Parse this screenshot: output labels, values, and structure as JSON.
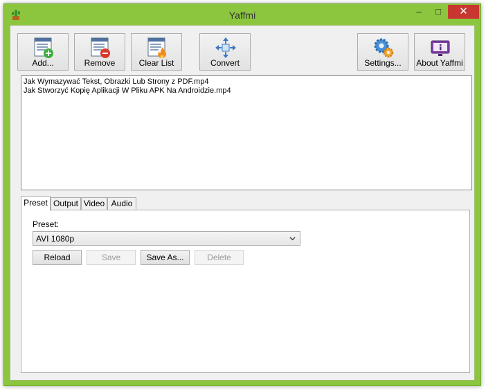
{
  "window": {
    "title": "Yaffmi",
    "app_icon": "cactus-icon",
    "controls": {
      "minimize": "–",
      "maximize": "□",
      "close": "✕"
    },
    "accent_color": "#8cc63f",
    "close_color": "#c7372f"
  },
  "toolbar": {
    "buttons": [
      {
        "label": "Add...",
        "icon": "add-list-icon"
      },
      {
        "label": "Remove",
        "icon": "remove-list-icon"
      },
      {
        "label": "Clear List",
        "icon": "clear-list-icon"
      },
      {
        "label": "Convert",
        "icon": "convert-icon"
      },
      {
        "label": "Settings...",
        "icon": "settings-gears-icon"
      },
      {
        "label": "About Yaffmi",
        "icon": "info-icon"
      }
    ]
  },
  "files": [
    "Jak Wymazywać Tekst, Obrazki Lub Strony z PDF.mp4",
    "Jak Stworzyć Kopię Aplikacji W Pliku APK Na Androidzie.mp4"
  ],
  "tabs": [
    {
      "label": "Preset",
      "active": true
    },
    {
      "label": "Output",
      "active": false
    },
    {
      "label": "Video",
      "active": false
    },
    {
      "label": "Audio",
      "active": false
    }
  ],
  "preset_panel": {
    "label": "Preset:",
    "selected": "AVI 1080p",
    "buttons": [
      {
        "label": "Reload",
        "enabled": true
      },
      {
        "label": "Save",
        "enabled": false
      },
      {
        "label": "Save As...",
        "enabled": true
      },
      {
        "label": "Delete",
        "enabled": false
      }
    ]
  }
}
